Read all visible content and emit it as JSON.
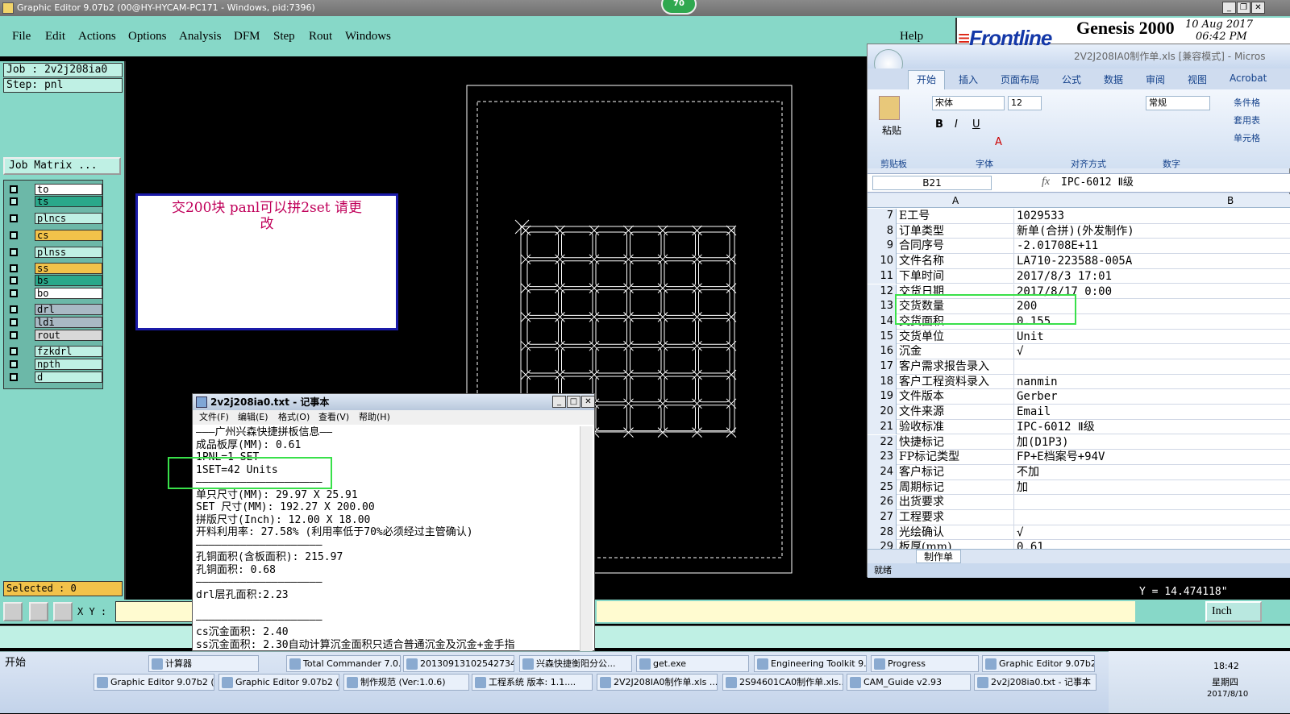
{
  "window": {
    "title": "Graphic Editor 9.07b2 (00@HY-HYCAM-PC171 - Windows, pid:7396)",
    "badge": "70"
  },
  "menu": [
    "File",
    "Edit",
    "Actions",
    "Options",
    "Analysis",
    "DFM",
    "Step",
    "Rout",
    "Windows"
  ],
  "help": "Help",
  "brand": {
    "frontline": "Frontline",
    "genesis": "Genesis 2000",
    "date": "10 Aug 2017",
    "time": "06:42 PM"
  },
  "job": {
    "job_line": "Job : 2v2j208ia0",
    "step_line": "Step: pnl",
    "matrix_button": "Job Matrix ...",
    "layers": [
      {
        "name": "to",
        "color": "#ffffff"
      },
      {
        "name": "ts",
        "color": "#2aa88a"
      },
      {
        "name": "plncs",
        "color": "#bff0e4"
      },
      {
        "name": "cs",
        "color": "#f2c24a"
      },
      {
        "name": "plnss",
        "color": "#bff0e4"
      },
      {
        "name": "ss",
        "color": "#f2c24a"
      },
      {
        "name": "bs",
        "color": "#2aa88a"
      },
      {
        "name": "bo",
        "color": "#ffffff"
      },
      {
        "name": "drl",
        "color": "#a9b9c4"
      },
      {
        "name": "ldi",
        "color": "#a9b9c4"
      },
      {
        "name": "rout",
        "color": "#d8d8d8"
      },
      {
        "name": "fzkdrl",
        "color": "#bff0e4"
      },
      {
        "name": "npth",
        "color": "#bff0e4"
      },
      {
        "name": "d",
        "color": "#bff0e4"
      }
    ],
    "selected": "Selected : 0"
  },
  "note": {
    "line1": "交200块    panl可以拼2set 请更",
    "line2": "改"
  },
  "bottom": {
    "xy_label": "X Y :",
    "y_readout": "Y = 14.474118\"",
    "unit": "Inch"
  },
  "notepad": {
    "title": "2v2j208ia0.txt - 记事本",
    "menus": [
      "文件(F)",
      "编辑(E)",
      "格式(O)",
      "查看(V)",
      "帮助(H)"
    ],
    "lines": [
      "———广州兴森快捷拼板信息——",
      "成品板厚(MM): 0.61",
      "1PNL=1 SET",
      "1SET=42 Units",
      "————————————————————",
      "单只尺寸(MM): 29.97 X 25.91",
      "SET 尺寸(MM): 192.27 X 200.00",
      "拼版尺寸(Inch): 12.00 X 18.00",
      "开料利用率: 27.58% (利用率低于70%必须经过主管确认)",
      "————————————————————",
      "孔铜面积(含板面积): 215.97",
      "孔铜面积: 0.68",
      "————————————————————",
      "drl层孔面积:2.23",
      "",
      "————————————————————",
      "cs沉金面积: 2.40",
      "ss沉金面积: 2.30自动计算沉金面积只适合普通沉金及沉金+金手指"
    ]
  },
  "excel": {
    "title": "2V2J208IA0制作单.xls  [兼容模式] - Micros",
    "tabs": [
      "开始",
      "插入",
      "页面布局",
      "公式",
      "数据",
      "审阅",
      "视图",
      "Acrobat"
    ],
    "font_name": "宋体",
    "font_size": "12",
    "number_format": "常规",
    "groups": [
      "剪贴板",
      "字体",
      "对齐方式",
      "数字"
    ],
    "paste": "粘贴",
    "right_tools": [
      "条件格",
      "套用表",
      "单元格"
    ],
    "cell_ref": "B21",
    "fx": "fx",
    "formula": "IPC-6012 Ⅱ级",
    "col_a": "A",
    "col_b": "B",
    "rows": [
      {
        "n": "7",
        "a": "E工号",
        "b": "1029533"
      },
      {
        "n": "8",
        "a": "订单类型",
        "b": "新单(合拼)(外发制作)"
      },
      {
        "n": "9",
        "a": "合同序号",
        "b": "-2.01708E+11"
      },
      {
        "n": "10",
        "a": "文件名称",
        "b": "LA710-223588-005A"
      },
      {
        "n": "11",
        "a": "下单时间",
        "b": "2017/8/3 17:01"
      },
      {
        "n": "12",
        "a": "交货日期",
        "b": "2017/8/17 0:00"
      },
      {
        "n": "13",
        "a": "交货数量",
        "b": "200"
      },
      {
        "n": "14",
        "a": "交货面积",
        "b": "0.155"
      },
      {
        "n": "15",
        "a": "交货单位",
        "b": "Unit"
      },
      {
        "n": "16",
        "a": "沉金",
        "b": "√"
      },
      {
        "n": "17",
        "a": "客户需求报告录入",
        "b": ""
      },
      {
        "n": "18",
        "a": "客户工程资料录入",
        "b": "nanmin"
      },
      {
        "n": "19",
        "a": "文件版本",
        "b": "Gerber"
      },
      {
        "n": "20",
        "a": "文件来源",
        "b": "Email"
      },
      {
        "n": "21",
        "a": "验收标准",
        "b": "IPC-6012 Ⅱ级"
      },
      {
        "n": "22",
        "a": "快捷标记",
        "b": "加(D1P3)"
      },
      {
        "n": "23",
        "a": "FP标记类型",
        "b": "FP+E档案号+94V"
      },
      {
        "n": "24",
        "a": "客户标记",
        "b": "不加"
      },
      {
        "n": "25",
        "a": "周期标记",
        "b": "加"
      },
      {
        "n": "26",
        "a": "出货要求",
        "b": ""
      },
      {
        "n": "27",
        "a": "工程要求",
        "b": ""
      },
      {
        "n": "28",
        "a": "光绘确认",
        "b": "√"
      },
      {
        "n": "29",
        "a": "板厚(mm)",
        "b": "0.61"
      }
    ],
    "sheet_tab": "制作单",
    "status": "就绪"
  },
  "taskbar": {
    "start": "开始",
    "row1": [
      "计算器",
      "Total Commander 7.0...",
      "20130913102542734...",
      "兴森快捷衡阳分公...",
      "get.exe",
      "Engineering Toolkit 9....",
      "Progress",
      "Graphic Editor 9.07b2..."
    ],
    "row2": [
      "Graphic Editor 9.07b2 (0...",
      "Graphic Editor 9.07b2 (0...",
      "制作规范 (Ver:1.0.6)",
      "工程系统  版本: 1.1....",
      "2V2J208IA0制作单.xls ...",
      "2S94601CA0制作单.xls...",
      "CAM_Guide v2.93",
      "2v2j208ia0.txt - 记事本"
    ],
    "clock": "18:42",
    "weekday": "星期四",
    "date": "2017/8/10"
  }
}
